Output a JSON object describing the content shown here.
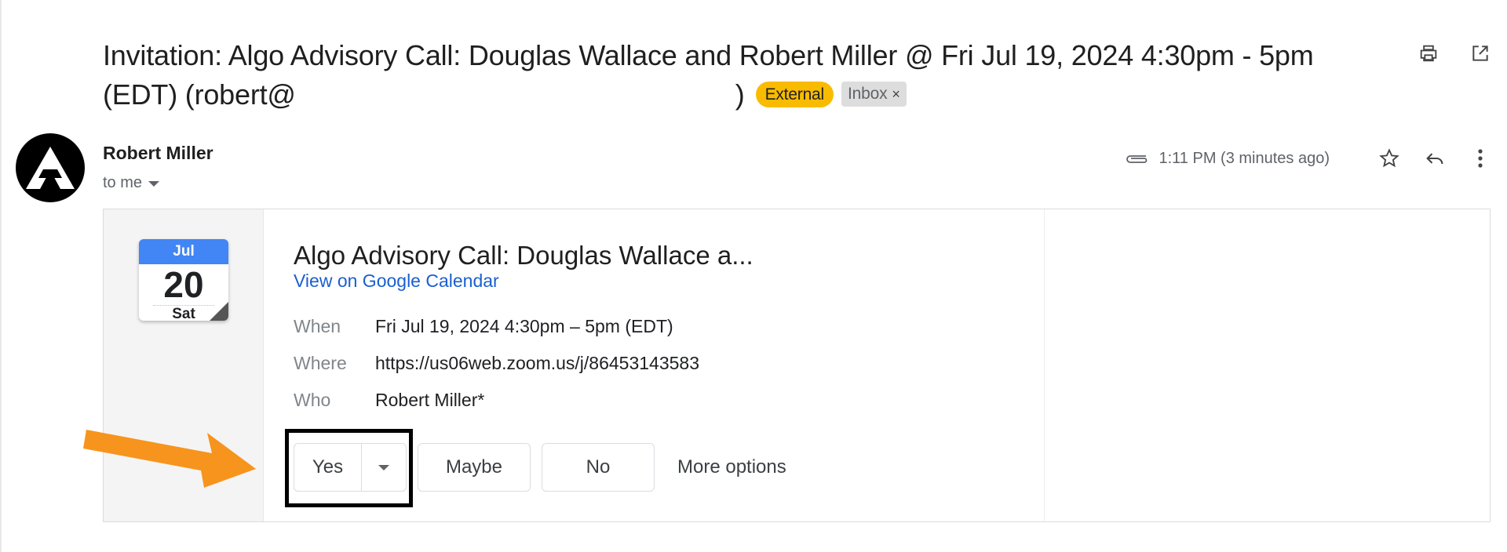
{
  "subject": {
    "line": "Invitation: Algo Advisory Call: Douglas Wallace and Robert Miller @ Fri Jul 19, 2024 4:30pm - 5pm (EDT) (robert@",
    "close_paren": ")",
    "labels": {
      "external": "External",
      "inbox": "Inbox",
      "inbox_remove": "×"
    }
  },
  "toolbar": {
    "icons": [
      "print-icon",
      "open-in-new-window-icon"
    ]
  },
  "message": {
    "sender": "Robert Miller",
    "recipient": "to me",
    "time": "1:11 PM (3 minutes ago)",
    "icons": [
      "attachment-icon",
      "star-icon",
      "reply-icon",
      "more-vert-icon"
    ]
  },
  "event": {
    "calendar": {
      "month": "Jul",
      "day": "20",
      "weekday": "Sat"
    },
    "title": "Algo Advisory Call: Douglas Wallace a...",
    "link": "View on Google Calendar",
    "details": [
      {
        "label": "When",
        "value": "Fri Jul 19, 2024 4:30pm – 5pm (EDT)"
      },
      {
        "label": "Where",
        "value": "https://us06web.zoom.us/j/86453143583"
      },
      {
        "label": "Who",
        "value": "Robert Miller*"
      }
    ],
    "rsvp": {
      "yes": "Yes",
      "maybe": "Maybe",
      "no": "No",
      "more": "More options"
    }
  },
  "colors": {
    "external_chip": "#f9bb00",
    "calendar_header": "#4285f4",
    "link": "#1a5fd0",
    "arrow": "#f7941d"
  }
}
